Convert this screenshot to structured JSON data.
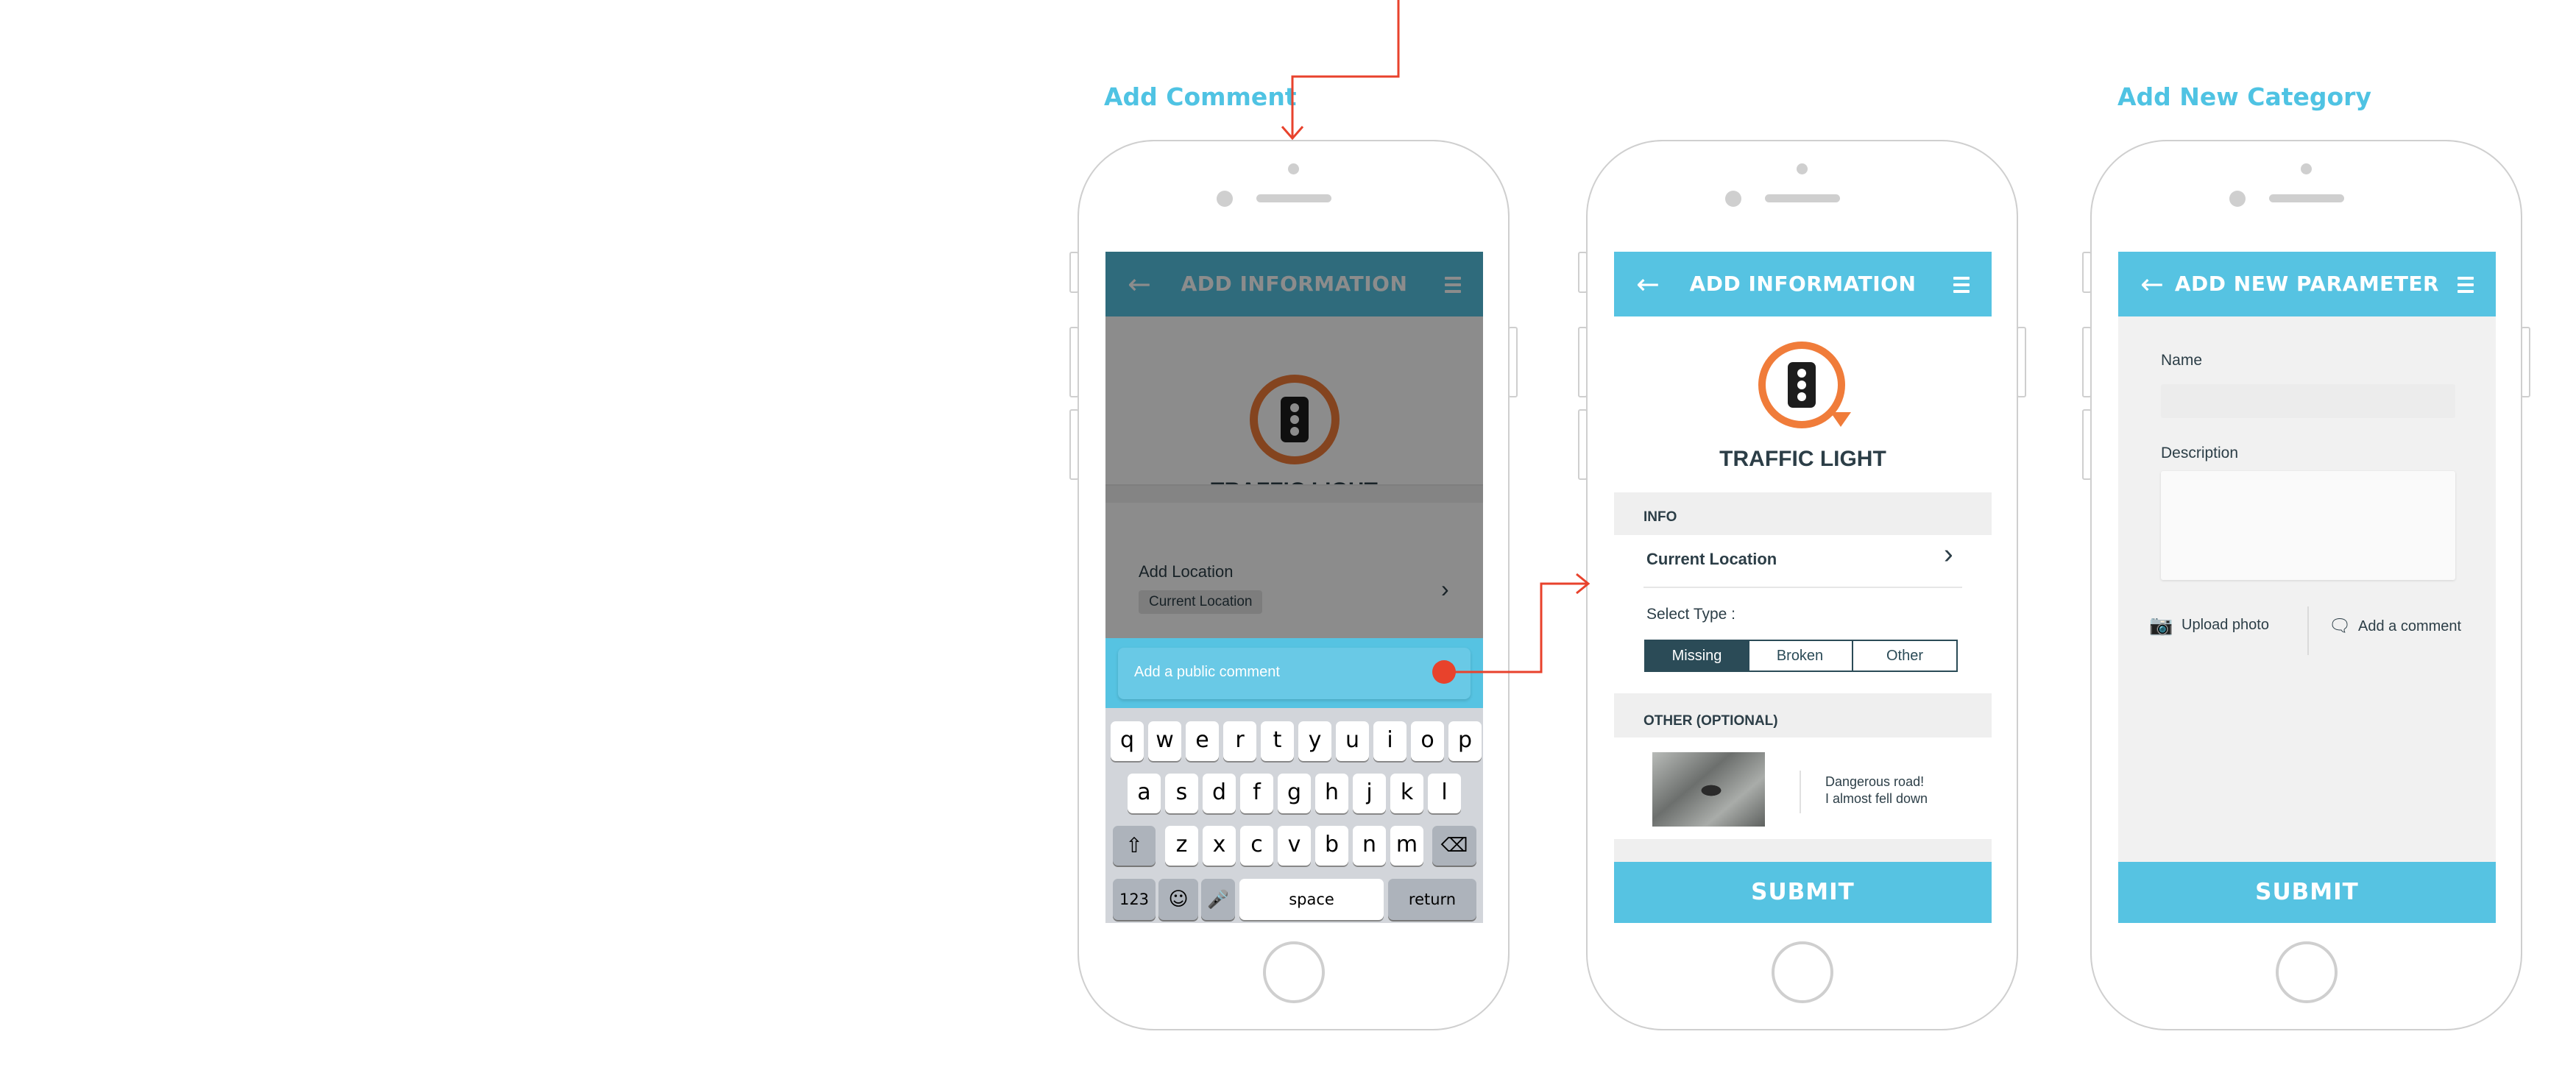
{
  "page_titles": {
    "add_comment": "Add Comment",
    "add_new_category": "Add New Category"
  },
  "phone1": {
    "appbar_title": "ADD INFORMATION",
    "item_title": "TRAFFIC LIGHT",
    "add_location_label": "Add Location",
    "current_location_chip": "Current Location",
    "comment_placeholder": "Add a public comment",
    "keyboard": {
      "row1": [
        "q",
        "w",
        "e",
        "r",
        "t",
        "y",
        "u",
        "i",
        "o",
        "p"
      ],
      "row2": [
        "a",
        "s",
        "d",
        "f",
        "g",
        "h",
        "j",
        "k",
        "l"
      ],
      "row3": [
        "z",
        "x",
        "c",
        "v",
        "b",
        "n",
        "m"
      ],
      "numbers_key": "123",
      "space_key": "space",
      "return_key": "return"
    }
  },
  "phone2": {
    "appbar_title": "ADD INFORMATION",
    "item_title": "TRAFFIC LIGHT",
    "info_header": "INFO",
    "current_location": "Current Location",
    "select_type_label": "Select Type :",
    "type_options": [
      "Missing",
      "Broken",
      "Other"
    ],
    "selected_type": "Missing",
    "other_header": "OTHER (OPTIONAL)",
    "comment_line1": "Dangerous road!",
    "comment_line2": "I almost fell down",
    "submit_label": "SUBMIT"
  },
  "phone3": {
    "appbar_title": "ADD NEW PARAMETER",
    "name_label": "Name",
    "description_label": "Description",
    "upload_photo_label": "Upload photo",
    "add_comment_label": "Add a comment",
    "submit_label": "SUBMIT"
  },
  "colors": {
    "accent": "#56c3e2",
    "title_blue": "#4fc3e3",
    "arrow_red": "#e8422c",
    "icon_orange": "#f07c3a",
    "dark_teal": "#2b4b57",
    "dim_overlay": "rgba(0,0,0,0.45)"
  },
  "icons": [
    "back-arrow-icon",
    "menu-icon",
    "traffic-light-icon",
    "chevron-right-icon",
    "camera-icon",
    "speech-bubble-icon",
    "shift-icon",
    "backspace-icon",
    "emoji-icon",
    "microphone-icon"
  ]
}
